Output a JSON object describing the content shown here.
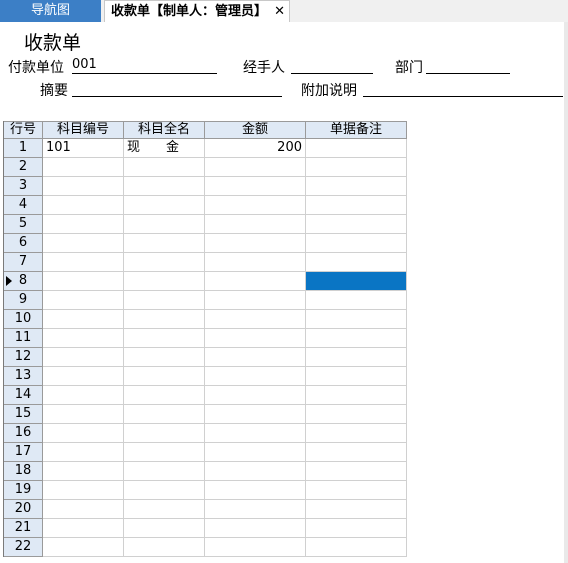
{
  "tabs": {
    "nav_label": "导航图",
    "active_label": "收款单【制单人：管理员】",
    "close_glyph": "✕"
  },
  "form": {
    "title": "收款单",
    "payer_label": "付款单位",
    "payer_value": "001",
    "handler_label": "经手人",
    "handler_value": "",
    "dept_label": "部门",
    "dept_value": "",
    "summary_label": "摘要",
    "summary_value": "",
    "note_label": "附加说明",
    "note_value": ""
  },
  "grid": {
    "columns": [
      "行号",
      "科目编号",
      "科目全名",
      "金额",
      "单据备注"
    ],
    "rows": [
      {
        "no": "1",
        "code": "101",
        "name": "现　　金",
        "amount": "200",
        "remark": ""
      },
      {
        "no": "2",
        "code": "",
        "name": "",
        "amount": "",
        "remark": ""
      },
      {
        "no": "3",
        "code": "",
        "name": "",
        "amount": "",
        "remark": ""
      },
      {
        "no": "4",
        "code": "",
        "name": "",
        "amount": "",
        "remark": ""
      },
      {
        "no": "5",
        "code": "",
        "name": "",
        "amount": "",
        "remark": ""
      },
      {
        "no": "6",
        "code": "",
        "name": "",
        "amount": "",
        "remark": ""
      },
      {
        "no": "7",
        "code": "",
        "name": "",
        "amount": "",
        "remark": ""
      },
      {
        "no": "8",
        "code": "",
        "name": "",
        "amount": "",
        "remark": ""
      },
      {
        "no": "9",
        "code": "",
        "name": "",
        "amount": "",
        "remark": ""
      },
      {
        "no": "10",
        "code": "",
        "name": "",
        "amount": "",
        "remark": ""
      },
      {
        "no": "11",
        "code": "",
        "name": "",
        "amount": "",
        "remark": ""
      },
      {
        "no": "12",
        "code": "",
        "name": "",
        "amount": "",
        "remark": ""
      },
      {
        "no": "13",
        "code": "",
        "name": "",
        "amount": "",
        "remark": ""
      },
      {
        "no": "14",
        "code": "",
        "name": "",
        "amount": "",
        "remark": ""
      },
      {
        "no": "15",
        "code": "",
        "name": "",
        "amount": "",
        "remark": ""
      },
      {
        "no": "16",
        "code": "",
        "name": "",
        "amount": "",
        "remark": ""
      },
      {
        "no": "17",
        "code": "",
        "name": "",
        "amount": "",
        "remark": ""
      },
      {
        "no": "18",
        "code": "",
        "name": "",
        "amount": "",
        "remark": ""
      },
      {
        "no": "19",
        "code": "",
        "name": "",
        "amount": "",
        "remark": ""
      },
      {
        "no": "20",
        "code": "",
        "name": "",
        "amount": "",
        "remark": ""
      },
      {
        "no": "21",
        "code": "",
        "name": "",
        "amount": "",
        "remark": ""
      },
      {
        "no": "22",
        "code": "",
        "name": "",
        "amount": "",
        "remark": ""
      }
    ],
    "current_row": 8,
    "selected_color": "#0a75c4"
  }
}
